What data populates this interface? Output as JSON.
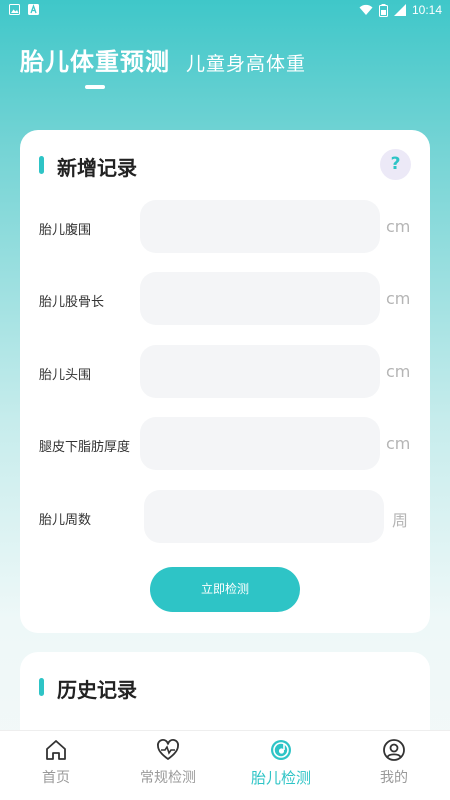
{
  "status_bar": {
    "time": "10:14"
  },
  "header": {
    "tabs": [
      {
        "label": "胎儿体重预测",
        "active": true
      },
      {
        "label": "儿童身高体重",
        "active": false
      }
    ]
  },
  "form": {
    "title": "新增记录",
    "help_icon": "?",
    "fields": [
      {
        "label": "胎儿腹围",
        "value": "",
        "unit": "cm"
      },
      {
        "label": "胎儿股骨长",
        "value": "",
        "unit": "cm"
      },
      {
        "label": "胎儿头围",
        "value": "",
        "unit": "cm"
      },
      {
        "label": "腿皮下脂肪厚度",
        "value": "",
        "unit": "cm"
      },
      {
        "label": "胎儿周数",
        "value": "",
        "unit": "周"
      }
    ],
    "submit_label": "立即检测"
  },
  "history": {
    "title": "历史记录"
  },
  "bottom_nav": {
    "items": [
      {
        "label": "首页",
        "icon": "home-icon",
        "active": false
      },
      {
        "label": "常规检测",
        "icon": "heart-pulse-icon",
        "active": false
      },
      {
        "label": "胎儿检测",
        "icon": "fetus-icon",
        "active": true
      },
      {
        "label": "我的",
        "icon": "profile-icon",
        "active": false
      }
    ]
  },
  "colors": {
    "accent": "#2ec4c6",
    "header_gradient_top": "#3fc7c9",
    "inactive_nav": "#9a9a9a"
  }
}
